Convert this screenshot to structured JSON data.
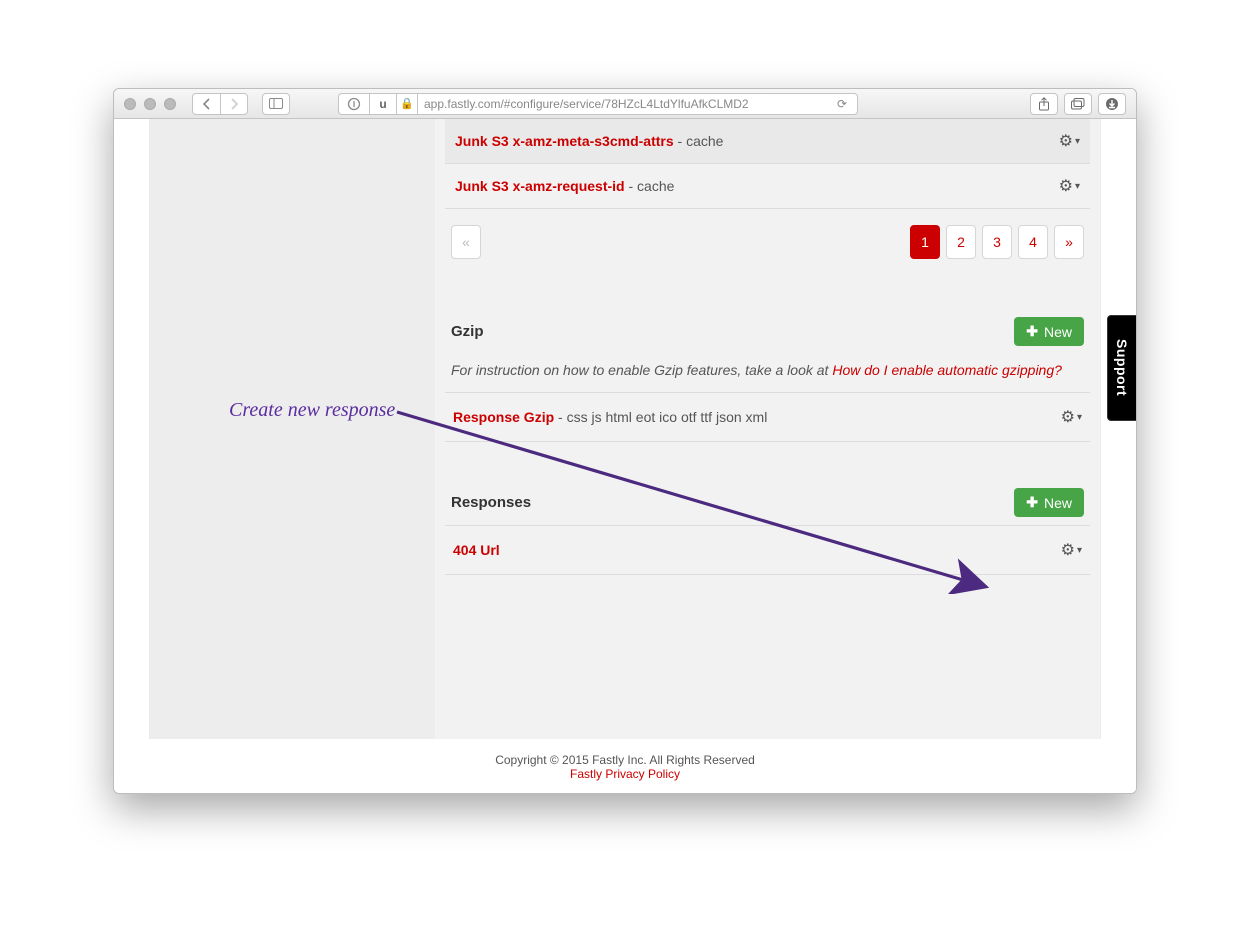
{
  "browser": {
    "url": "app.fastly.com/#configure/service/78HZcL4LtdYlfuAfkCLMD2",
    "btn_u": "u",
    "plus": "+"
  },
  "headers": [
    {
      "name": "Junk S3 x-amz-meta-s3cmd-attrs",
      "suffix": " - cache"
    },
    {
      "name": "Junk S3 x-amz-request-id",
      "suffix": " - cache"
    }
  ],
  "pagination": {
    "prev": "«",
    "pages": [
      "1",
      "2",
      "3",
      "4"
    ],
    "next": "»",
    "active_index": 0
  },
  "gzip": {
    "title": "Gzip",
    "new_label": "New",
    "instruction_prefix": "For instruction on how to enable Gzip features, take a look at ",
    "instruction_link": "How do I enable automatic gzipping?",
    "item_name": "Response Gzip",
    "item_suffix": " - css js html eot ico otf ttf json xml"
  },
  "responses": {
    "title": "Responses",
    "new_label": "New",
    "item_name": "404 Url"
  },
  "footer": {
    "copyright": "Copyright © 2015 Fastly Inc. All Rights Reserved",
    "policy_link": "Fastly Privacy Policy"
  },
  "support_tab": "Support",
  "annotation": "Create new response"
}
